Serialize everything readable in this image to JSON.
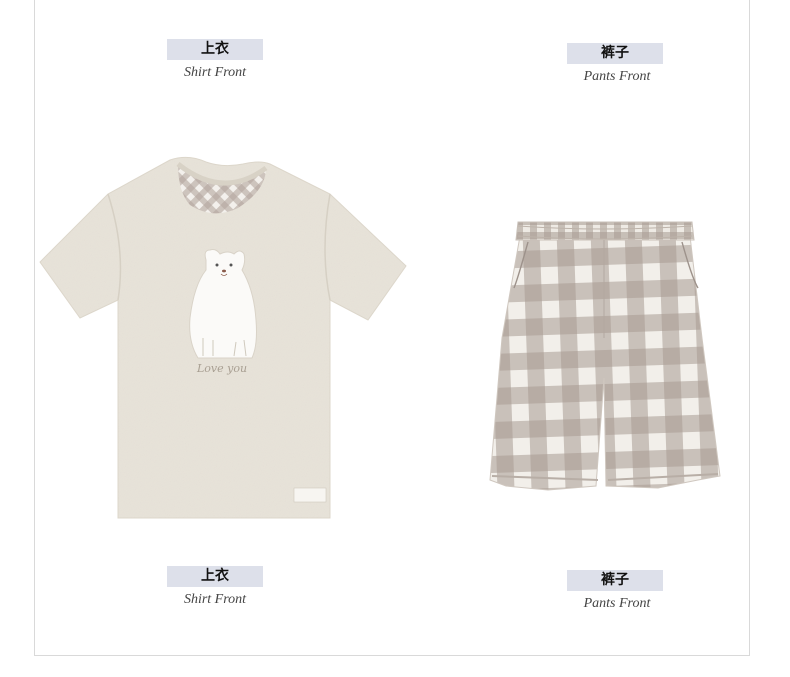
{
  "shirt": {
    "label_cn": "上衣",
    "label_en": "Shirt Front"
  },
  "pants": {
    "label_cn": "裤子",
    "label_en": "Pants Front"
  },
  "graphic": {
    "text": "Love you"
  },
  "colors": {
    "label_bg": "#dde0ea",
    "shirt": "#e8e3d9",
    "check": "#a89a92",
    "frame": "#d9d9d9"
  }
}
